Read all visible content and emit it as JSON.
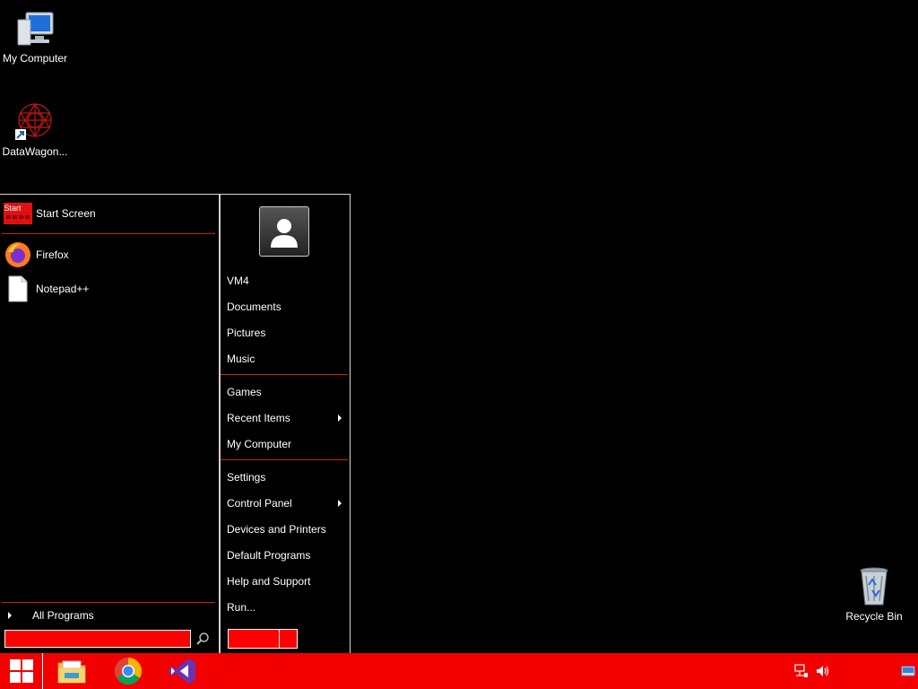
{
  "desktop": {
    "icons": [
      {
        "label": "My Computer",
        "icon": "computer-icon"
      },
      {
        "label": "DataWagon...",
        "icon": "datawagon-shortcut-icon"
      },
      {
        "label": "Recycle Bin",
        "icon": "recycle-bin-icon"
      }
    ]
  },
  "start_menu": {
    "pinned": [
      {
        "label": "Start Screen",
        "icon": "start-screen-icon",
        "icon_text": "Start"
      },
      {
        "label": "Firefox",
        "icon": "firefox-icon"
      },
      {
        "label": "Notepad++",
        "icon": "notepad-icon"
      }
    ],
    "all_programs_label": "All Programs",
    "search": {
      "value": "",
      "placeholder": ""
    },
    "right_items": [
      {
        "label": "VM4"
      },
      {
        "label": "Documents"
      },
      {
        "label": "Pictures"
      },
      {
        "label": "Music"
      },
      {
        "label": "Games"
      },
      {
        "label": "Recent Items",
        "submenu": true
      },
      {
        "label": "My Computer"
      },
      {
        "label": "Settings"
      },
      {
        "label": "Control Panel",
        "submenu": true
      },
      {
        "label": "Devices and Printers"
      },
      {
        "label": "Default Programs"
      },
      {
        "label": "Help and Support"
      },
      {
        "label": "Run..."
      }
    ]
  },
  "taskbar": {
    "apps": [
      "file-explorer-icon",
      "chrome-icon",
      "visual-studio-icon"
    ],
    "tray": [
      "network-icon",
      "volume-icon",
      "show-desktop-icon"
    ]
  },
  "colors": {
    "accent": "#f20000",
    "separator": "#c8201c"
  }
}
